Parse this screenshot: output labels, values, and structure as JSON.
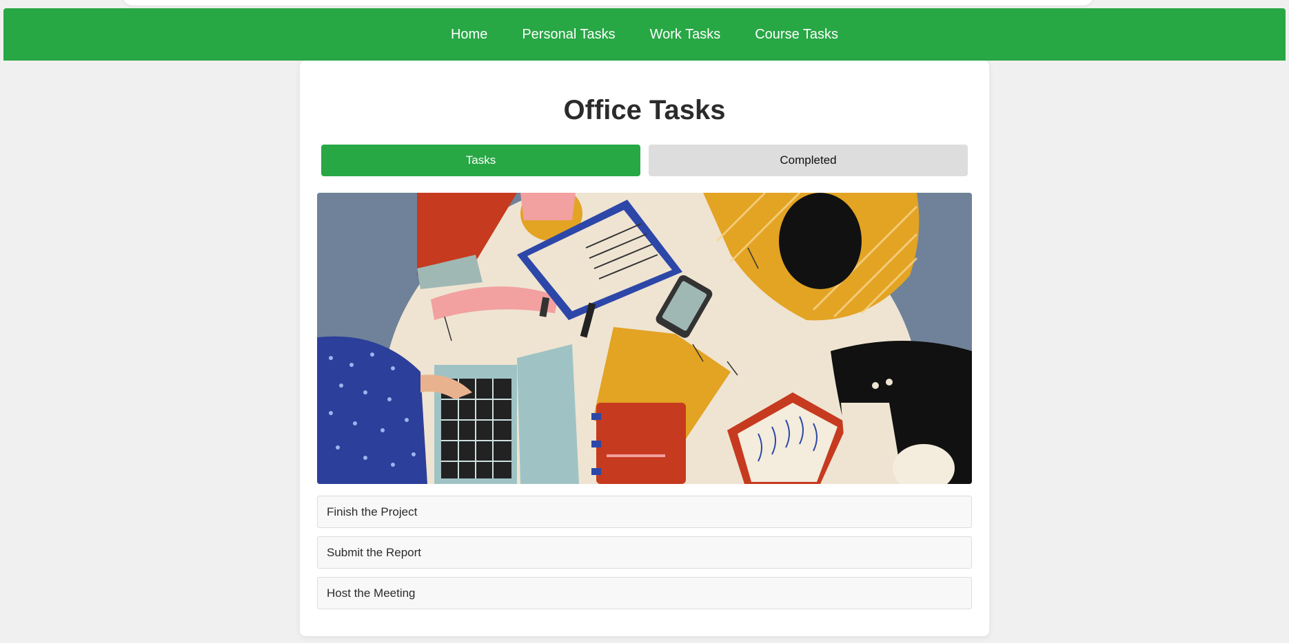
{
  "nav": {
    "items": [
      {
        "label": "Home"
      },
      {
        "label": "Personal Tasks"
      },
      {
        "label": "Work Tasks"
      },
      {
        "label": "Course Tasks"
      }
    ]
  },
  "page": {
    "title": "Office Tasks"
  },
  "tabs": {
    "tasks_label": "Tasks",
    "completed_label": "Completed"
  },
  "illustration": {
    "icon": "office-team-table-illustration"
  },
  "tasks": [
    {
      "label": "Finish the Project"
    },
    {
      "label": "Submit the Report"
    },
    {
      "label": "Host the Meeting"
    }
  ],
  "colors": {
    "accent": "#28a745",
    "background": "#f0f0f0",
    "inactive_tab": "#dddddd"
  }
}
